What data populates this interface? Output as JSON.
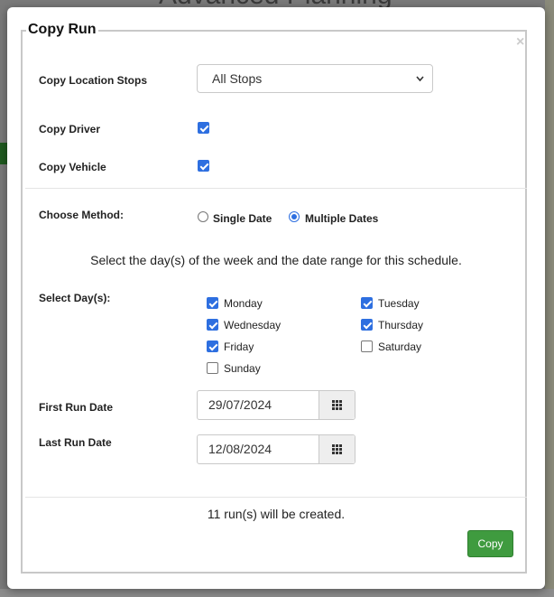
{
  "background": {
    "page_title": "Advanced Planning"
  },
  "dialog": {
    "title": "Copy Run",
    "close_glyph": "×",
    "copy_location_stops": {
      "label": "Copy Location Stops",
      "selected": "All Stops"
    },
    "copy_driver": {
      "label": "Copy Driver",
      "checked": true
    },
    "copy_vehicle": {
      "label": "Copy Vehicle",
      "checked": true
    },
    "choose_method": {
      "label": "Choose Method:",
      "options": [
        {
          "label": "Single Date",
          "selected": false
        },
        {
          "label": "Multiple Dates",
          "selected": true
        }
      ]
    },
    "instruction": "Select the day(s) of the week and the date range for this schedule.",
    "select_days": {
      "label": "Select Day(s):",
      "days": [
        {
          "label": "Monday",
          "checked": true
        },
        {
          "label": "Tuesday",
          "checked": true
        },
        {
          "label": "Wednesday",
          "checked": true
        },
        {
          "label": "Thursday",
          "checked": true
        },
        {
          "label": "Friday",
          "checked": true
        },
        {
          "label": "Saturday",
          "checked": false
        },
        {
          "label": "Sunday",
          "checked": false
        }
      ]
    },
    "first_run_date": {
      "label": "First Run Date",
      "value": "29/07/2024"
    },
    "last_run_date": {
      "label": "Last Run Date",
      "value": "12/08/2024"
    },
    "result_text": "11 run(s) will be created.",
    "copy_button": "Copy"
  },
  "colors": {
    "accent": "#2e6fe0",
    "copy_button": "#3f9b3f"
  },
  "icons": {
    "calendar": "grid-icon",
    "select_arrow": "chevron-down-icon"
  }
}
